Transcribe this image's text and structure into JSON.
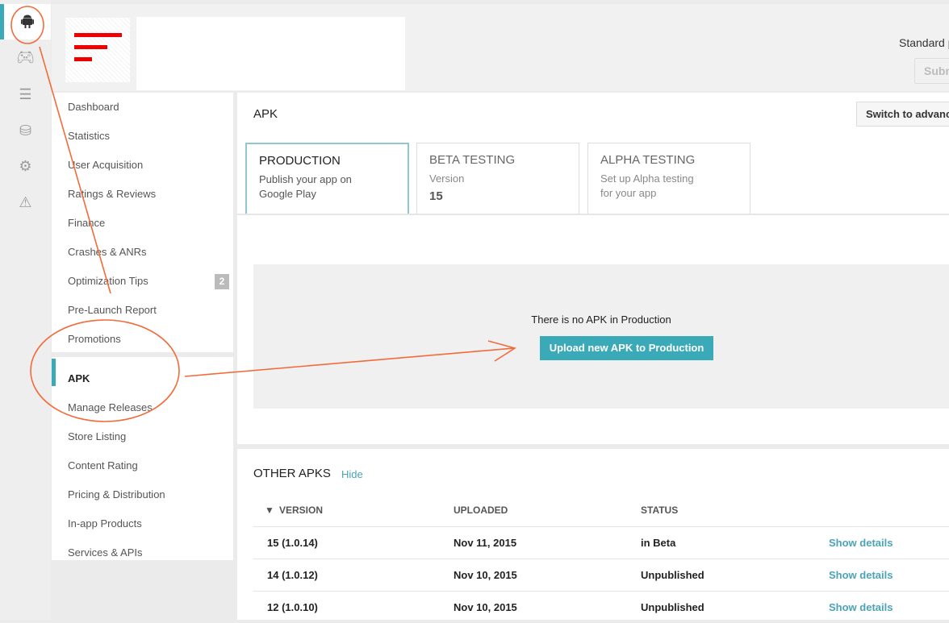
{
  "rail": {
    "items": [
      {
        "icon": "android-icon",
        "active": true
      },
      {
        "icon": "gamepad-icon"
      },
      {
        "icon": "list-icon"
      },
      {
        "icon": "database-icon"
      },
      {
        "icon": "gear-icon"
      },
      {
        "icon": "warning-icon"
      }
    ]
  },
  "header": {
    "standard": "Standard p",
    "submit": "Subm"
  },
  "nav": {
    "items": [
      "Dashboard",
      "Statistics",
      "User Acquisition",
      "Ratings & Reviews",
      "Finance",
      "Crashes & ANRs",
      "Optimization Tips",
      "Pre-Launch Report",
      "Promotions",
      "APK",
      "Manage Releases",
      "Store Listing",
      "Content Rating",
      "Pricing & Distribution",
      "In-app Products",
      "Services & APIs"
    ],
    "optimization_badge": "2",
    "active": "APK"
  },
  "main": {
    "title": "APK",
    "switch_label": "Switch to advanc",
    "tabs": [
      {
        "title": "PRODUCTION",
        "line1": "Publish your app on",
        "line2": "Google Play"
      },
      {
        "title": "BETA TESTING",
        "line1": "Version",
        "value": "15"
      },
      {
        "title": "ALPHA TESTING",
        "line1": "Set up Alpha testing",
        "line2": "for your app"
      }
    ],
    "empty_text": "There is no APK in Production",
    "upload_label": "Upload new APK to Production"
  },
  "other": {
    "title": "OTHER APKS",
    "hide": "Hide",
    "headers": [
      "VERSION",
      "UPLOADED",
      "STATUS"
    ],
    "rows": [
      {
        "version": "15 (1.0.14)",
        "uploaded": "Nov 11, 2015",
        "status": "in Beta",
        "action": "Show details"
      },
      {
        "version": "14 (1.0.12)",
        "uploaded": "Nov 10, 2015",
        "status": "Unpublished",
        "action": "Show details"
      },
      {
        "version": "12 (1.0.10)",
        "uploaded": "Nov 10, 2015",
        "status": "Unpublished",
        "action": "Show details"
      }
    ]
  },
  "colors": {
    "accent": "#3aa9b8",
    "annotation": "#f26b3a"
  }
}
